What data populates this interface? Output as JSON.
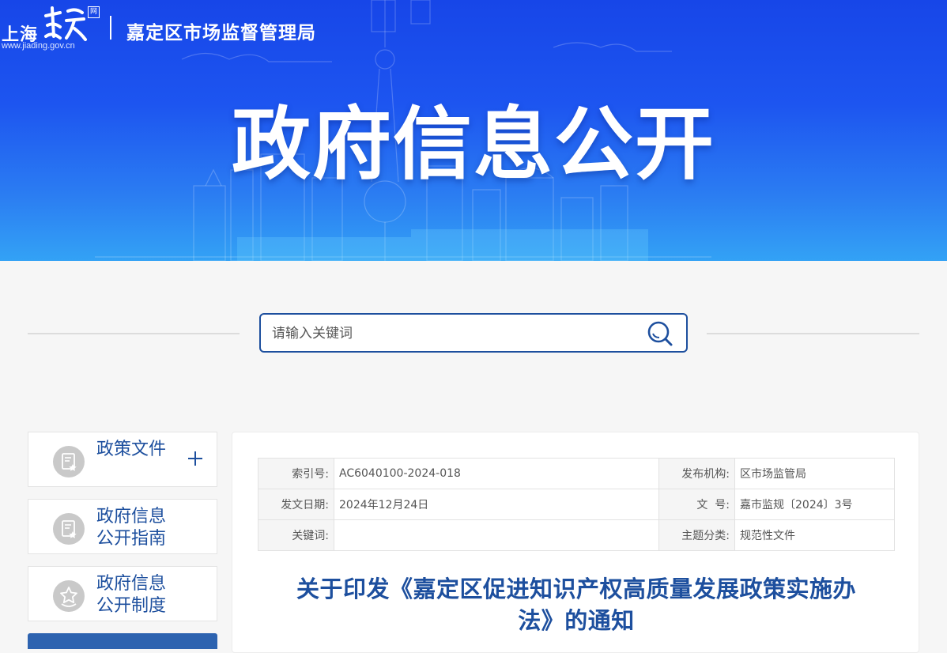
{
  "header": {
    "logo_city": "上海",
    "logo_mark": "嘉定",
    "logo_seal": "网",
    "logo_url": "www.jiading.gov.cn",
    "bureau": "嘉定区市场监督管理局",
    "banner_title": "政府信息公开"
  },
  "search": {
    "placeholder": "请输入关键词",
    "icon": "search-icon"
  },
  "sidebar": {
    "items": [
      {
        "label_lines": [
          "政策文件"
        ],
        "icon": "document-star-icon",
        "expand_icon": "plus-icon"
      },
      {
        "label_lines": [
          "政府信息",
          "公开指南"
        ],
        "icon": "document-star-icon"
      },
      {
        "label_lines": [
          "政府信息",
          "公开制度"
        ],
        "icon": "badge-star-icon"
      }
    ]
  },
  "meta": {
    "rows": [
      {
        "k1": "索引号:",
        "v1": "AC6040100-2024-018",
        "k2": "发布机构:",
        "v2": "区市场监管局"
      },
      {
        "k1": "发文日期:",
        "v1": "2024年12月24日",
        "k2": "文  号:",
        "v2": "嘉市监规〔2024〕3号"
      },
      {
        "k1": "关键词:",
        "v1": "",
        "k2": "主题分类:",
        "v2": "规范性文件"
      }
    ]
  },
  "document": {
    "title_line1": "关于印发《嘉定区促进知识产权高质量发展政策实施办",
    "title_line2": "法》的通知"
  },
  "colors": {
    "banner_top": "#1746e8",
    "banner_bottom": "#33a2f5",
    "accent": "#1d4f9e",
    "sidebar_active": "#2d63b0"
  }
}
